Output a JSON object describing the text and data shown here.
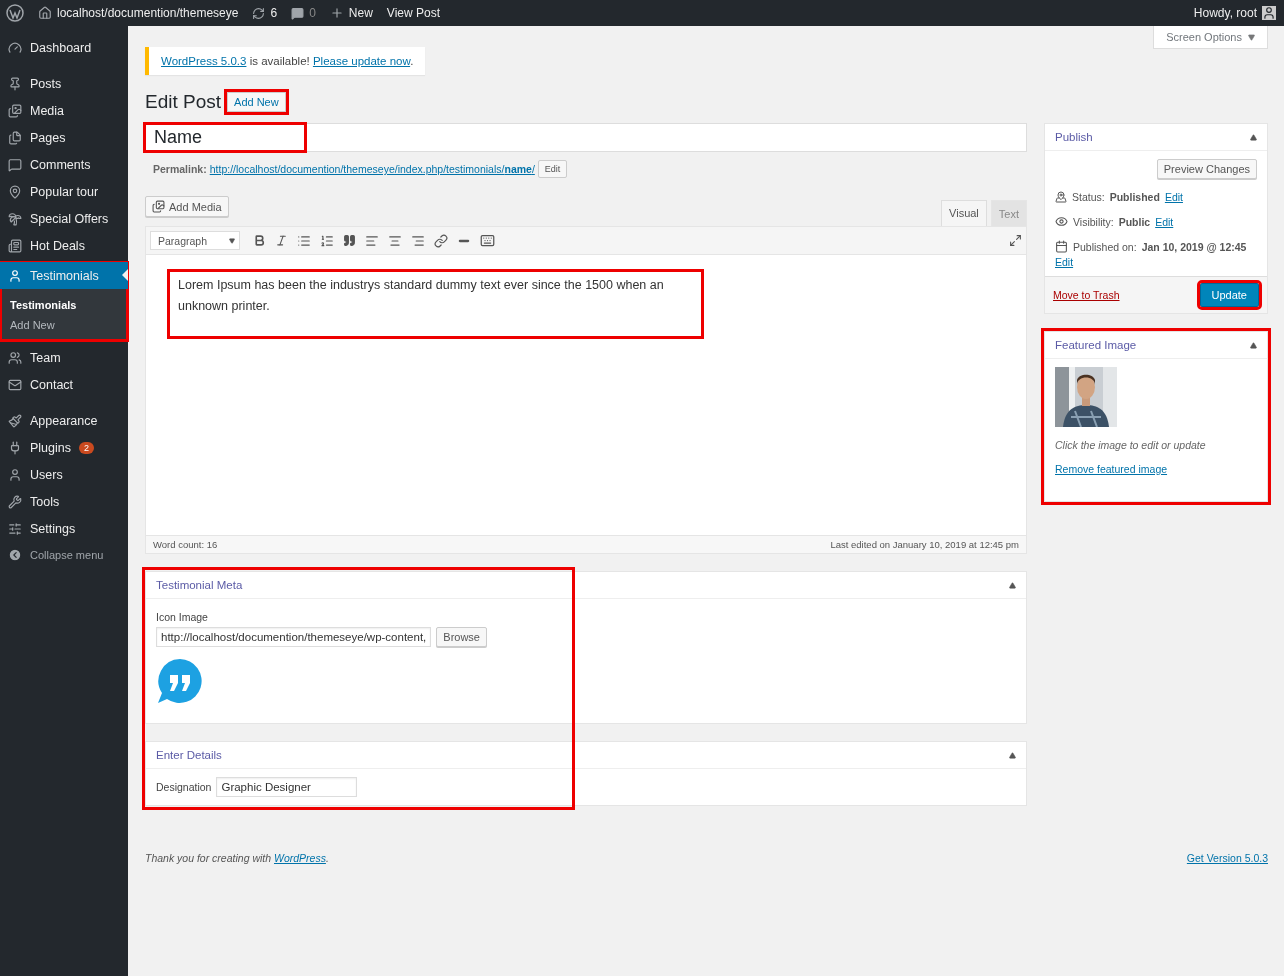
{
  "admin_bar": {
    "site": "localhost/documention/themeseye",
    "updates": "6",
    "comments": "0",
    "new": "New",
    "view": "View Post",
    "greeting": "Howdy, root"
  },
  "sidebar": {
    "items": [
      {
        "label": "Dashboard",
        "selected": false
      },
      {
        "label": "Posts",
        "selected": false
      },
      {
        "label": "Media",
        "selected": false
      },
      {
        "label": "Pages",
        "selected": false
      },
      {
        "label": "Comments",
        "selected": false
      },
      {
        "label": "Popular tour",
        "selected": false
      },
      {
        "label": "Special Offers",
        "selected": false
      },
      {
        "label": "Hot Deals",
        "selected": false
      },
      {
        "label": "Testimonials",
        "selected": true,
        "highlighted": true,
        "children": [
          {
            "label": "Testimonials",
            "selected": true
          },
          {
            "label": "Add New",
            "selected": false
          }
        ]
      },
      {
        "label": "Team",
        "selected": false
      },
      {
        "label": "Contact",
        "selected": false
      },
      {
        "label": "Appearance",
        "selected": false
      },
      {
        "label": "Plugins",
        "selected": false,
        "badge": "2"
      },
      {
        "label": "Users",
        "selected": false
      },
      {
        "label": "Tools",
        "selected": false
      },
      {
        "label": "Settings",
        "selected": false
      }
    ],
    "collapse": "Collapse menu"
  },
  "screen_options": "Screen Options",
  "notice": {
    "link": "WordPress 5.0.3",
    "text": " is available! ",
    "action": "Please update now",
    "end": "."
  },
  "heading": {
    "title": "Edit Post",
    "add_new": "Add New",
    "highlighted": true
  },
  "post_title": {
    "value": "Name",
    "highlighted": true
  },
  "permalink": {
    "label": "Permalink:",
    "url": "http://localhost/documention/themeseye/index.php/testimonials/**name**/",
    "edit": "Edit"
  },
  "editor": {
    "add_media": "Add Media",
    "tabs": [
      {
        "label": "Visual",
        "selected": true
      },
      {
        "label": "Text",
        "selected": false
      }
    ],
    "format": "Paragraph",
    "content": "Lorem Ipsum has been the industrys standard dummy text ever since the 1500 when an unknown printer.",
    "highlighted": true,
    "word_count": "Word count: 16",
    "last_edited": "Last edited on January 10, 2019 at 12:45 pm"
  },
  "publish": {
    "title": "Publish",
    "preview": "Preview Changes",
    "status_label": "Status:",
    "status": "Published",
    "visibility_label": "Visibility:",
    "visibility": "Public",
    "published_label": "Published on:",
    "published": "Jan 10, 2019 @ 12:45",
    "status_edit": "Edit",
    "visibility_edit": "Edit",
    "date_edit": "Edit",
    "trash": "Move to Trash",
    "update": "Update",
    "update_highlighted": true
  },
  "featured_image": {
    "title": "Featured Image",
    "hint": "Click the image to edit or update",
    "remove": "Remove featured image",
    "highlighted": true
  },
  "testimonial_meta": {
    "title": "Testimonial Meta",
    "label": "Icon Image",
    "value": "http://localhost/documention/themeseye/wp-content,",
    "browse": "Browse"
  },
  "enter_details": {
    "title": "Enter Details",
    "label": "Designation",
    "value": "Graphic Designer"
  },
  "meta_highlighted": true,
  "footer": {
    "thanks": "Thank you for creating with ",
    "link": "WordPress",
    "end": ".",
    "version": "Get Version 5.0.3"
  }
}
